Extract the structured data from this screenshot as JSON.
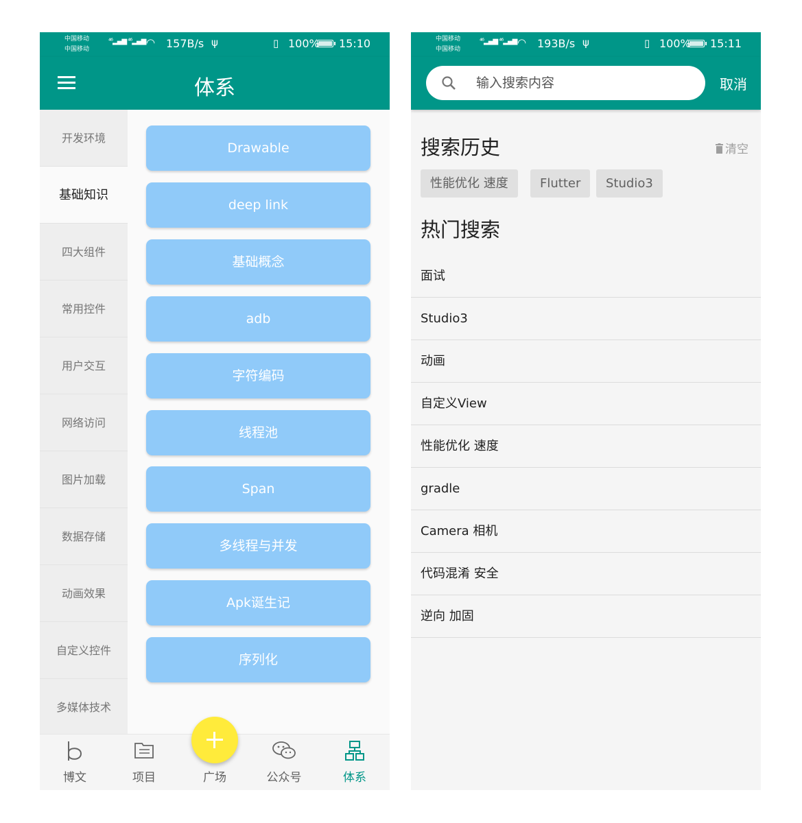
{
  "left_screen": {
    "status": {
      "carrier1": "中国移动",
      "carrier2": "中国移动",
      "speed": "157B/s",
      "battery": "100%",
      "time": "15:10"
    },
    "title": "体系",
    "categories": [
      "开发环境",
      "基础知识",
      "四大组件",
      "常用控件",
      "用户交互",
      "网络访问",
      "图片加载",
      "数据存储",
      "动画效果",
      "自定义控件",
      "多媒体技术"
    ],
    "active_category": "基础知识",
    "topics": [
      "Drawable",
      "deep link",
      "基础概念",
      "adb",
      "字符编码",
      "线程池",
      "Span",
      "多线程与并发",
      "Apk诞生记",
      "序列化"
    ],
    "bottom_nav": [
      {
        "label": "博文",
        "icon": "blog-icon"
      },
      {
        "label": "项目",
        "icon": "project-icon"
      },
      {
        "label": "广场",
        "icon": "plus-icon"
      },
      {
        "label": "公众号",
        "icon": "wechat-icon"
      },
      {
        "label": "体系",
        "icon": "system-icon"
      }
    ],
    "active_tab": "体系"
  },
  "right_screen": {
    "status": {
      "carrier1": "中国移动",
      "carrier2": "中国移动",
      "speed": "193B/s",
      "battery": "100%",
      "time": "15:11"
    },
    "search": {
      "placeholder": "输入搜索内容",
      "cancel_label": "取消"
    },
    "history_title": "搜索历史",
    "clear_label": "清空",
    "history": [
      "性能优化 速度",
      "Flutter",
      "Studio3"
    ],
    "hot_title": "热门搜索",
    "hot": [
      "面试",
      "Studio3",
      "动画",
      "自定义View",
      "性能优化 速度",
      "gradle",
      "Camera 相机",
      "代码混淆 安全",
      "逆向 加固"
    ]
  },
  "colors": {
    "primary": "#009688",
    "chip": "#90caf9",
    "fab": "#ffeb3b"
  }
}
